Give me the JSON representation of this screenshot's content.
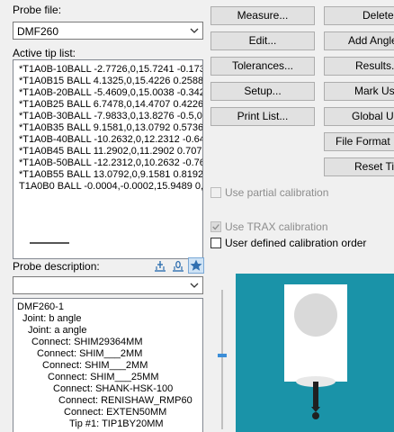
{
  "probe_file": {
    "label": "Probe file:",
    "value": "DMF260"
  },
  "active_tip_list": {
    "label": "Active tip list:",
    "rows": [
      "*T1A0B-10BALL -2.7726,0,15.7241 -0.173",
      "*T1A0B15 BALL 4.1325,0,15.4226 0.2588,",
      "*T1A0B-20BALL -5.4609,0,15.0038 -0.342",
      "*T1A0B25 BALL 6.7478,0,14.4707 0.4226,",
      "*T1A0B-30BALL -7.9833,0,13.8276 -0.5,0,",
      "*T1A0B35 BALL 9.1581,0,13.0792 0.5736,",
      "*T1A0B-40BALL -10.2632,0,12.2312 -0.64",
      "*T1A0B45 BALL 11.2902,0,11.2902 0.7071",
      "*T1A0B-50BALL -12.2312,0,10.2632 -0.76",
      "*T1A0B55 BALL 13.0792,0,9.1581 0.8192,",
      "T1A0B0 BALL -0.0004,-0.0002,15.9489 0,0"
    ]
  },
  "probe_description": {
    "label": "Probe description:",
    "select_value": "",
    "lines": [
      "DMF260-1",
      "Joint: b angle",
      "Joint: a angle",
      "Connect: SHIM29364MM",
      "Connect: SHIM___2MM",
      "Connect: SHIM___2MM",
      "Connect: SHIM___25MM",
      "Connect: SHANK-HSK-100",
      "Connect: RENISHAW_RMP60",
      "Connect: EXTEN50MM",
      "Tip #1: TIP1BY20MM"
    ]
  },
  "toolbar_icons": [
    "add-tip-icon",
    "edit-tip-icon",
    "favorite-star-icon"
  ],
  "buttons": {
    "measure": "Measure...",
    "edit": "Edit...",
    "tolerances": "Tolerances...",
    "setup": "Setup...",
    "print_list": "Print List...",
    "delete": "Delete",
    "add_angles": "Add Angles",
    "results": "Results...",
    "mark_used": "Mark Used",
    "global_used": "Global Used",
    "file_format": "File Format",
    "reset_tips": "Reset Tips"
  },
  "checkboxes": {
    "partial": {
      "label": "Use partial calibration",
      "checked": false,
      "enabled": false
    },
    "trax": {
      "label": "Use TRAX calibration",
      "checked": true,
      "enabled": false
    },
    "user_order": {
      "label": "User defined calibration order",
      "checked": false,
      "enabled": true
    }
  },
  "colors": {
    "preview_bg": "#1a93a8",
    "button_bg": "#e1e1e1",
    "accent": "#3c8ed8"
  }
}
